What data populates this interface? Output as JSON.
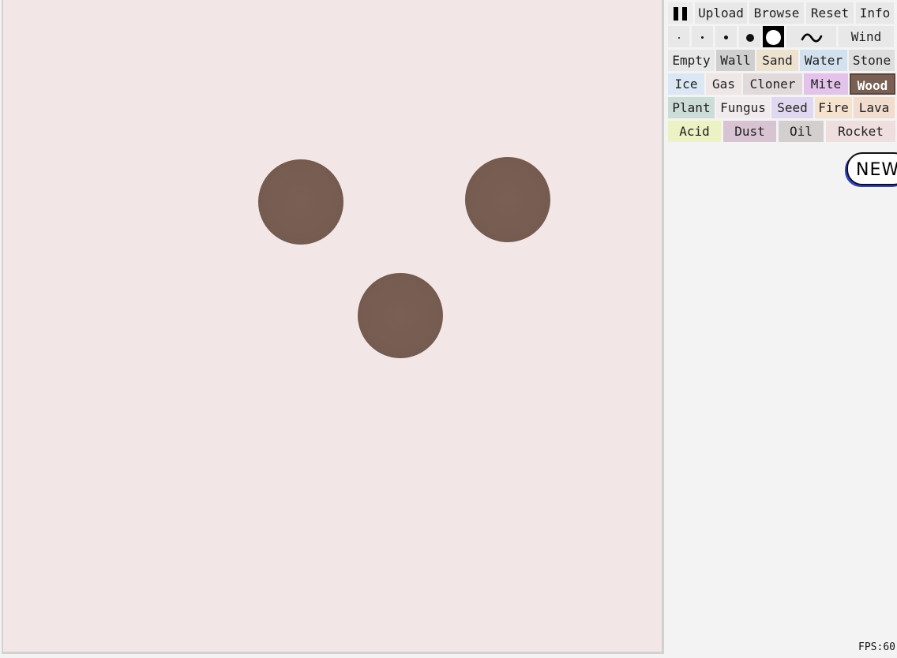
{
  "toolbar": {
    "pause_icon": "pause-icon",
    "upload": "Upload",
    "browse": "Browse",
    "reset": "Reset",
    "info": "Info"
  },
  "sizes": {
    "labels": [
      "·",
      "·",
      "•",
      "●",
      "○"
    ],
    "selected_index": 4,
    "wave_icon": "tilde-wave-icon",
    "wind": "Wind"
  },
  "elements": {
    "selected": "Wood",
    "rows": [
      [
        {
          "label": "Empty",
          "color": "#e8e8e8"
        },
        {
          "label": "Wall",
          "color": "#cfcfcf"
        },
        {
          "label": "Sand",
          "color": "#ede2cf"
        },
        {
          "label": "Water",
          "color": "#d3e1ef"
        },
        {
          "label": "Stone",
          "color": "#dedede"
        }
      ],
      [
        {
          "label": "Ice",
          "color": "#dbe7f4"
        },
        {
          "label": "Gas",
          "color": "#efe6e6"
        },
        {
          "label": "Cloner",
          "color": "#e2dada"
        },
        {
          "label": "Mite",
          "color": "#e3c3ea"
        },
        {
          "label": "Wood",
          "color": "#7a6054"
        }
      ],
      [
        {
          "label": "Plant",
          "color": "#ccdcd6"
        },
        {
          "label": "Fungus",
          "color": "#f2ebee"
        },
        {
          "label": "Seed",
          "color": "#e0d8f0"
        },
        {
          "label": "Fire",
          "color": "#f5e2cf"
        },
        {
          "label": "Lava",
          "color": "#f1dccd"
        }
      ],
      [
        {
          "label": "Acid",
          "color": "#ecf2c3"
        },
        {
          "label": "Dust",
          "color": "#d8c3d3"
        },
        {
          "label": "Oil",
          "color": "#d3cfcf"
        },
        {
          "label": "Rocket",
          "color": "#efdede"
        }
      ]
    ]
  },
  "badge": {
    "text": "NEW"
  },
  "status": {
    "fps": "FPS:60"
  },
  "colors": {
    "canvas_bg": "#f2e6e6",
    "wood": "#7a6054",
    "panel_bg": "#f3f3f3"
  }
}
